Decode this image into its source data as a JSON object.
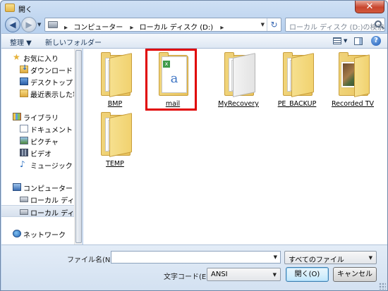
{
  "window": {
    "title": "開く",
    "close_label": "✕"
  },
  "navigation": {
    "back_glyph": "◀",
    "forward_glyph": "▶",
    "history_glyph": "▼",
    "path": [
      "コンピューター",
      "ローカル ディスク (D:)"
    ],
    "separator": "▸",
    "dropdown_glyph": "▼",
    "refresh_glyph": "↻",
    "search_placeholder": "ローカル ディスク (D:)の検索"
  },
  "toolbar": {
    "organize": "整理 ▼",
    "new_folder": "新しいフォルダー",
    "view_dd": "▼",
    "help": "?"
  },
  "sidebar": {
    "favorites": "お気に入り",
    "favorite_items": [
      "ダウンロード",
      "デスクトップ",
      "最近表示した場所"
    ],
    "libraries": "ライブラリ",
    "library_items": [
      "ドキュメント",
      "ピクチャ",
      "ビデオ",
      "ミュージック"
    ],
    "computer": "コンピューター",
    "computer_items": [
      "ローカル ディスク",
      "ローカル ディスク"
    ],
    "network": "ネットワーク"
  },
  "files": [
    {
      "name": "BMP",
      "icon": "folder-icon"
    },
    {
      "name": "mail",
      "icon": "mail-folder-icon"
    },
    {
      "name": "MyRecovery",
      "icon": "folder-icon"
    },
    {
      "name": "PE_BACKUP",
      "icon": "folder-icon"
    },
    {
      "name": "Recorded TV",
      "icon": "photo-folder-icon"
    },
    {
      "name": "TEMP",
      "icon": "folder-icon"
    }
  ],
  "footer": {
    "filename_label": "ファイル名(N):",
    "filename_value": "",
    "filetype_value": "すべてのファイル",
    "encoding_label": "文字コード(E):",
    "encoding_value": "ANSI",
    "open_button": "開く(O)",
    "cancel_button": "キャンセル",
    "dropdown_glyph": "▼"
  }
}
